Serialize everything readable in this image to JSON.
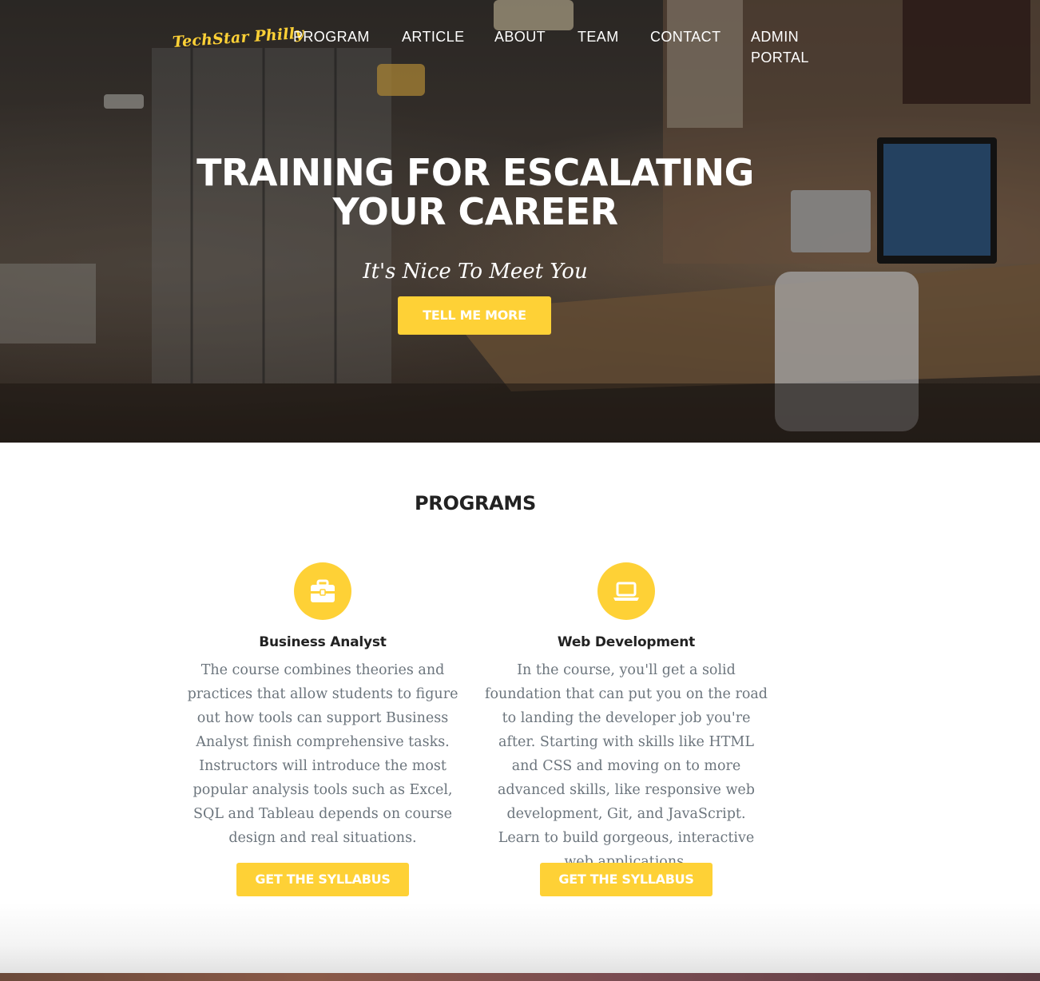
{
  "nav": {
    "brand": "TechStar Philly",
    "items": [
      {
        "label": "PROGRAM"
      },
      {
        "label": "ARTICLE"
      },
      {
        "label": "ABOUT"
      },
      {
        "label": "TEAM"
      },
      {
        "label": "CONTACT"
      },
      {
        "label": "ADMIN PORTAL"
      }
    ]
  },
  "hero": {
    "title": "TRAINING FOR ESCALATING YOUR CAREER",
    "subtitle": "It's Nice To Meet You",
    "button": "TELL ME MORE"
  },
  "programs": {
    "heading": "PROGRAMS",
    "items": [
      {
        "icon": "briefcase-icon",
        "title": "Business Analyst",
        "description": "The course combines theories and practices that allow students to figure out how tools can support Business Analyst finish comprehensive tasks. Instructors will introduce the most popular analysis tools such as Excel, SQL and Tableau depends on course design and real situations.",
        "button": "GET THE SYLLABUS"
      },
      {
        "icon": "laptop-icon",
        "title": "Web Development",
        "description": "In the course, you'll get a solid foundation that can put you on the road to landing the developer job you're after. Starting with skills like HTML and CSS and moving on to more advanced skills, like responsive web development, Git, and JavaScript. Learn to build gorgeous, interactive web applications.",
        "button": "GET THE SYLLABUS"
      }
    ]
  },
  "colors": {
    "accent": "#fed136",
    "heading": "#222222",
    "body_text": "#6c757d"
  }
}
